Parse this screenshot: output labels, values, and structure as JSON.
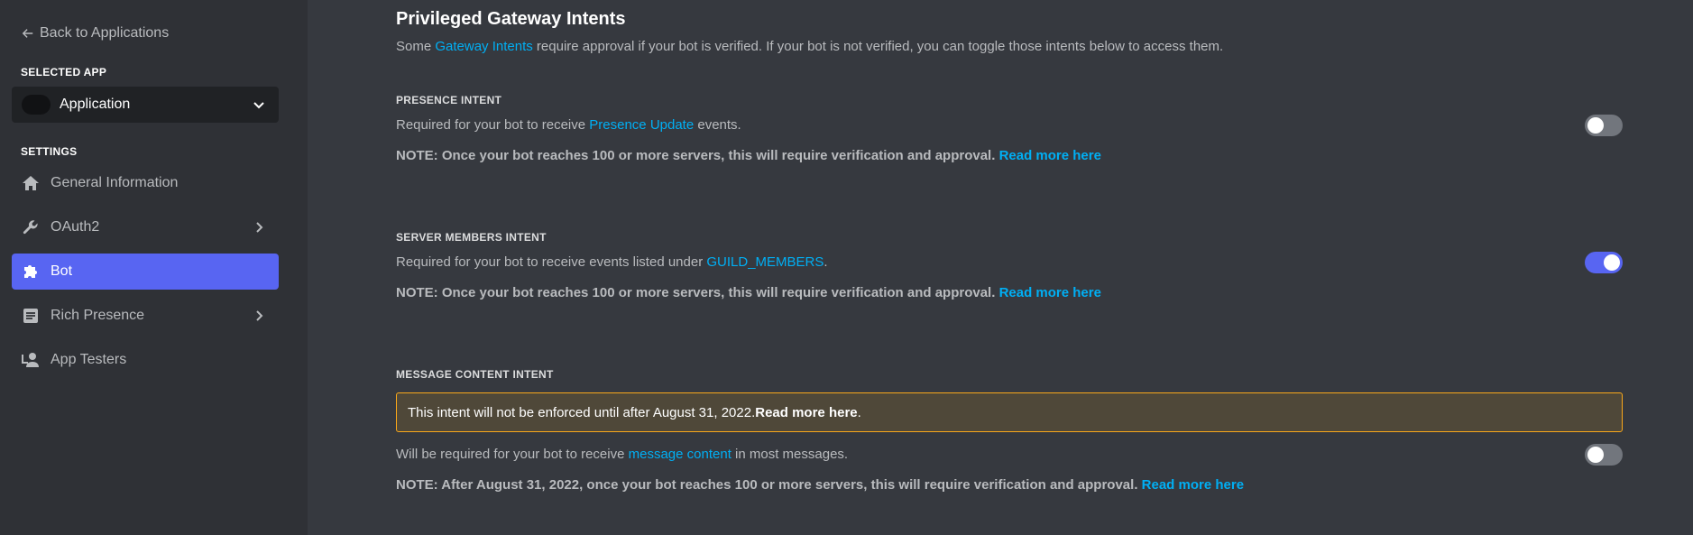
{
  "sidebar": {
    "back_label": "Back to Applications",
    "selected_app_label": "SELECTED APP",
    "app_name": "Application",
    "settings_label": "SETTINGS",
    "items": [
      {
        "label": "General Information"
      },
      {
        "label": "OAuth2"
      },
      {
        "label": "Bot"
      },
      {
        "label": "Rich Presence"
      },
      {
        "label": "App Testers"
      }
    ]
  },
  "main": {
    "title": "Privileged Gateway Intents",
    "desc_prefix": "Some ",
    "desc_link": "Gateway Intents",
    "desc_suffix": " require approval if your bot is verified. If your bot is not verified, you can toggle those intents below to access them.",
    "presence": {
      "label": "PRESENCE INTENT",
      "desc_prefix": "Required for your bot to receive ",
      "desc_link": "Presence Update",
      "desc_suffix": " events.",
      "note": "NOTE: Once your bot reaches 100 or more servers, this will require verification and approval. ",
      "note_link": "Read more here",
      "enabled": false
    },
    "members": {
      "label": "SERVER MEMBERS INTENT",
      "desc_prefix": "Required for your bot to receive events listed under ",
      "desc_link": "GUILD_MEMBERS",
      "desc_suffix": ".",
      "note": "NOTE: Once your bot reaches 100 or more servers, this will require verification and approval. ",
      "note_link": "Read more here",
      "enabled": true
    },
    "message": {
      "label": "MESSAGE CONTENT INTENT",
      "warning_text": "This intent will not be enforced until after August 31, 2022. ",
      "warning_link": "Read more here",
      "warning_end": ".",
      "desc_prefix": "Will be required for your bot to receive ",
      "desc_link": "message content",
      "desc_suffix": " in most messages.",
      "note": "NOTE: After August 31, 2022, once your bot reaches 100 or more servers, this will require verification and approval. ",
      "note_link": "Read more here",
      "enabled": false
    }
  },
  "colors": {
    "accent": "#5865f2",
    "link": "#00aff4",
    "warning_border": "#faa81a",
    "sidebar_bg": "#2f3136",
    "main_bg": "#36393f"
  },
  "icons": {
    "back": "arrow-left-icon",
    "general": "home-icon",
    "oauth2": "wrench-icon",
    "bot": "puzzle-icon",
    "rich_presence": "document-icon",
    "app_testers": "user-settings-icon",
    "chevron": "chevron-right-icon"
  }
}
